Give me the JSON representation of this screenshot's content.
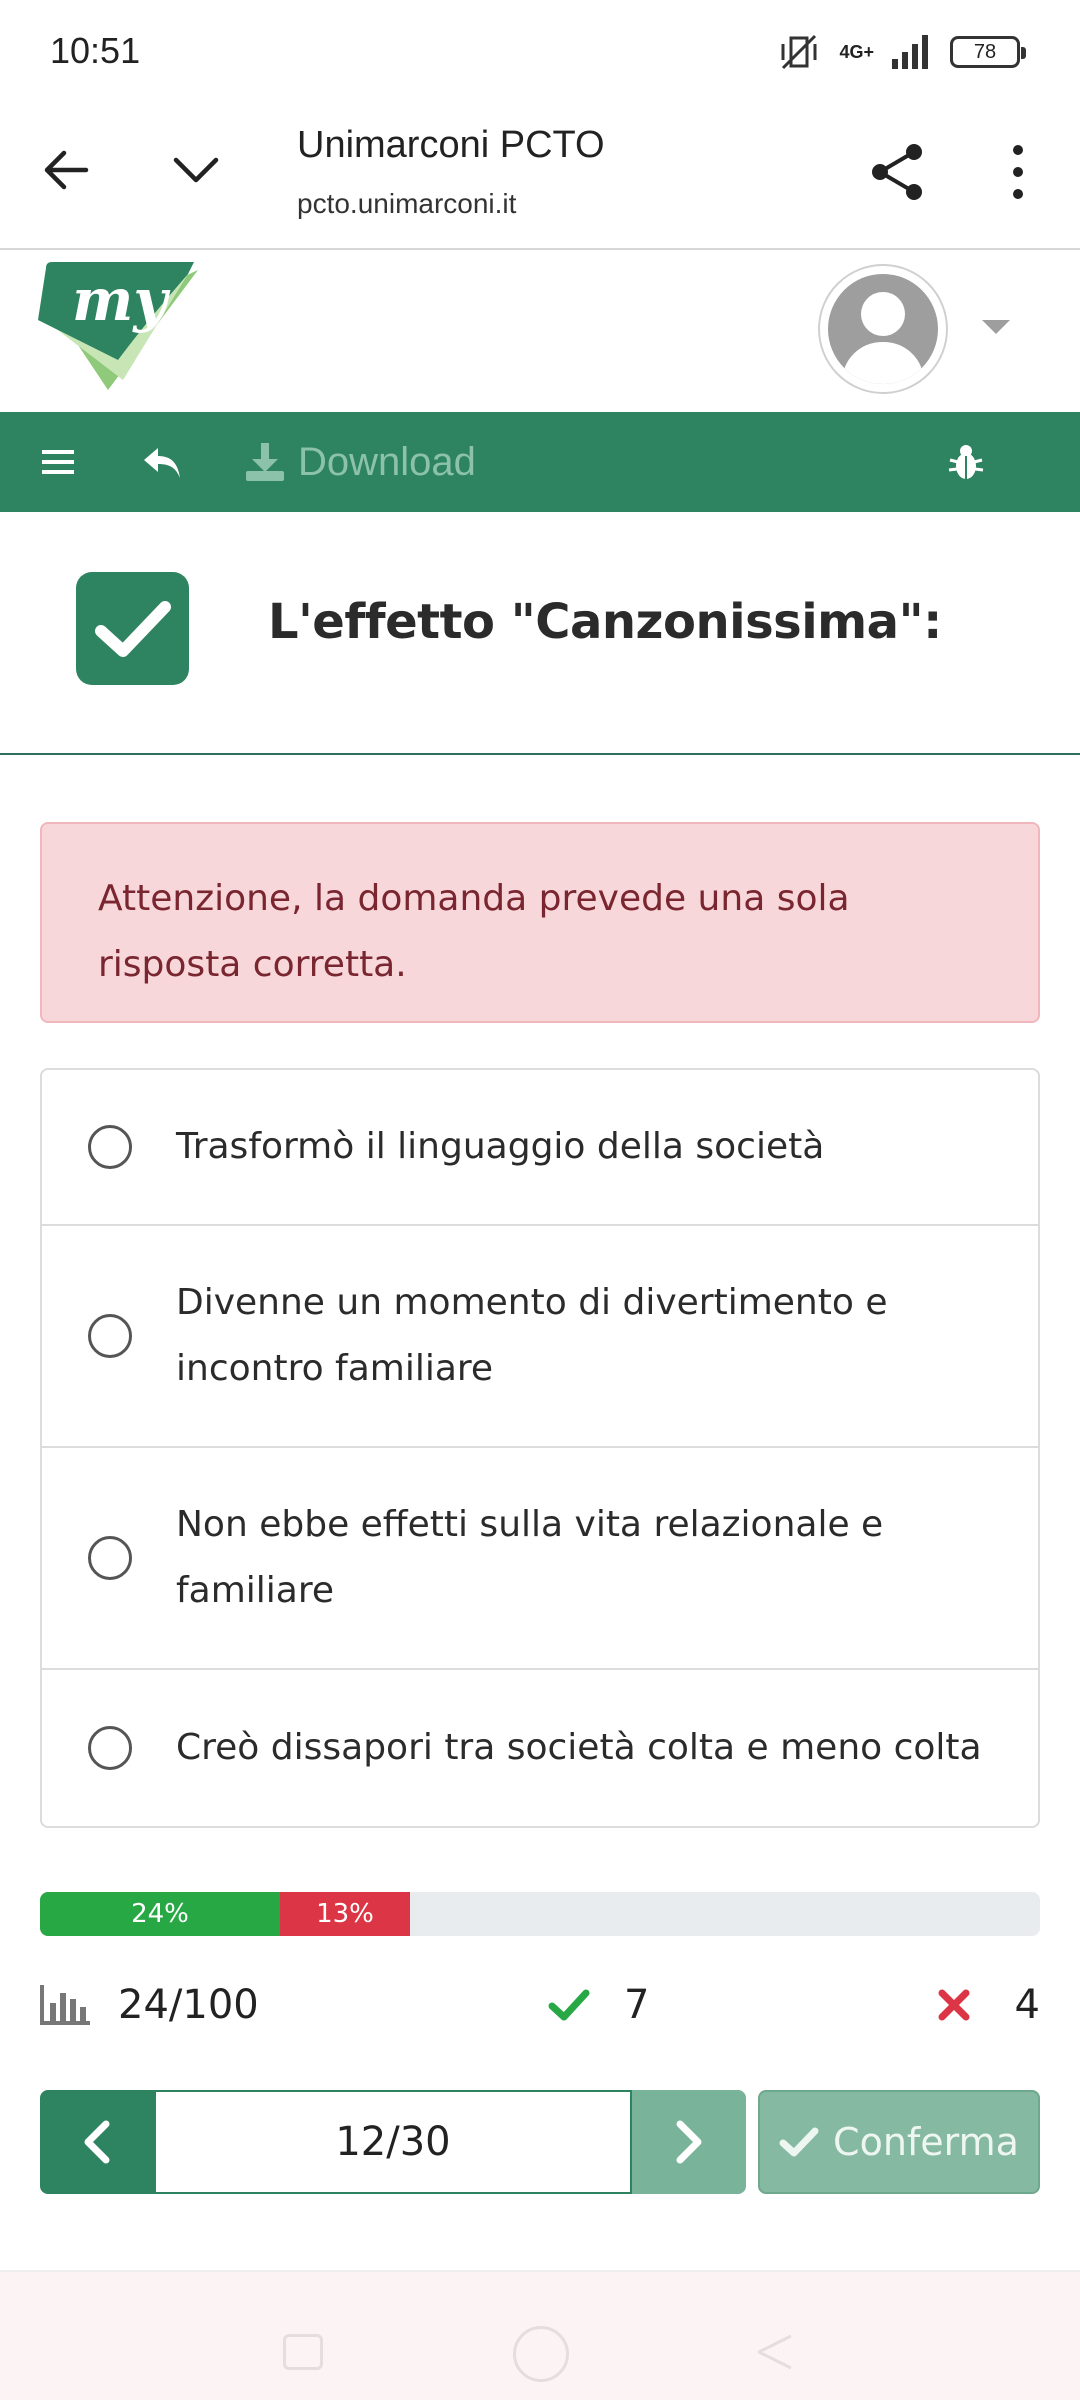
{
  "status_bar": {
    "time": "10:51",
    "network": "4G+",
    "battery": "78"
  },
  "browser": {
    "title": "Unimarconi PCTO",
    "url": "pcto.unimarconi.it"
  },
  "app": {
    "logo_text": "my"
  },
  "toolbar": {
    "download_label": "Download"
  },
  "question": {
    "title": "L'effetto \"Canzonissima\":",
    "alert": "Attenzione, la domanda prevede una sola risposta corretta.",
    "options": [
      {
        "label": "Trasformò il linguaggio della società",
        "selected": false
      },
      {
        "label": "Divenne un momento di divertimento e incontro familiare",
        "selected": false
      },
      {
        "label": "Non ebbe effetti sulla vita relazionale e familiare",
        "selected": false
      },
      {
        "label": "Creò dissapori tra società colta e meno colta",
        "selected": false
      }
    ]
  },
  "progress": {
    "correct_percent": 24,
    "wrong_percent": 13,
    "correct_label": "24%",
    "wrong_label": "13%"
  },
  "stats": {
    "score": "24/100",
    "correct": "7",
    "wrong": "4"
  },
  "navigation": {
    "page": "12/30",
    "confirm_label": "Conferma"
  },
  "colors": {
    "brand_green": "#2e8360",
    "success": "#28a745",
    "danger": "#dc3545",
    "alert_bg": "#f8d7da"
  }
}
